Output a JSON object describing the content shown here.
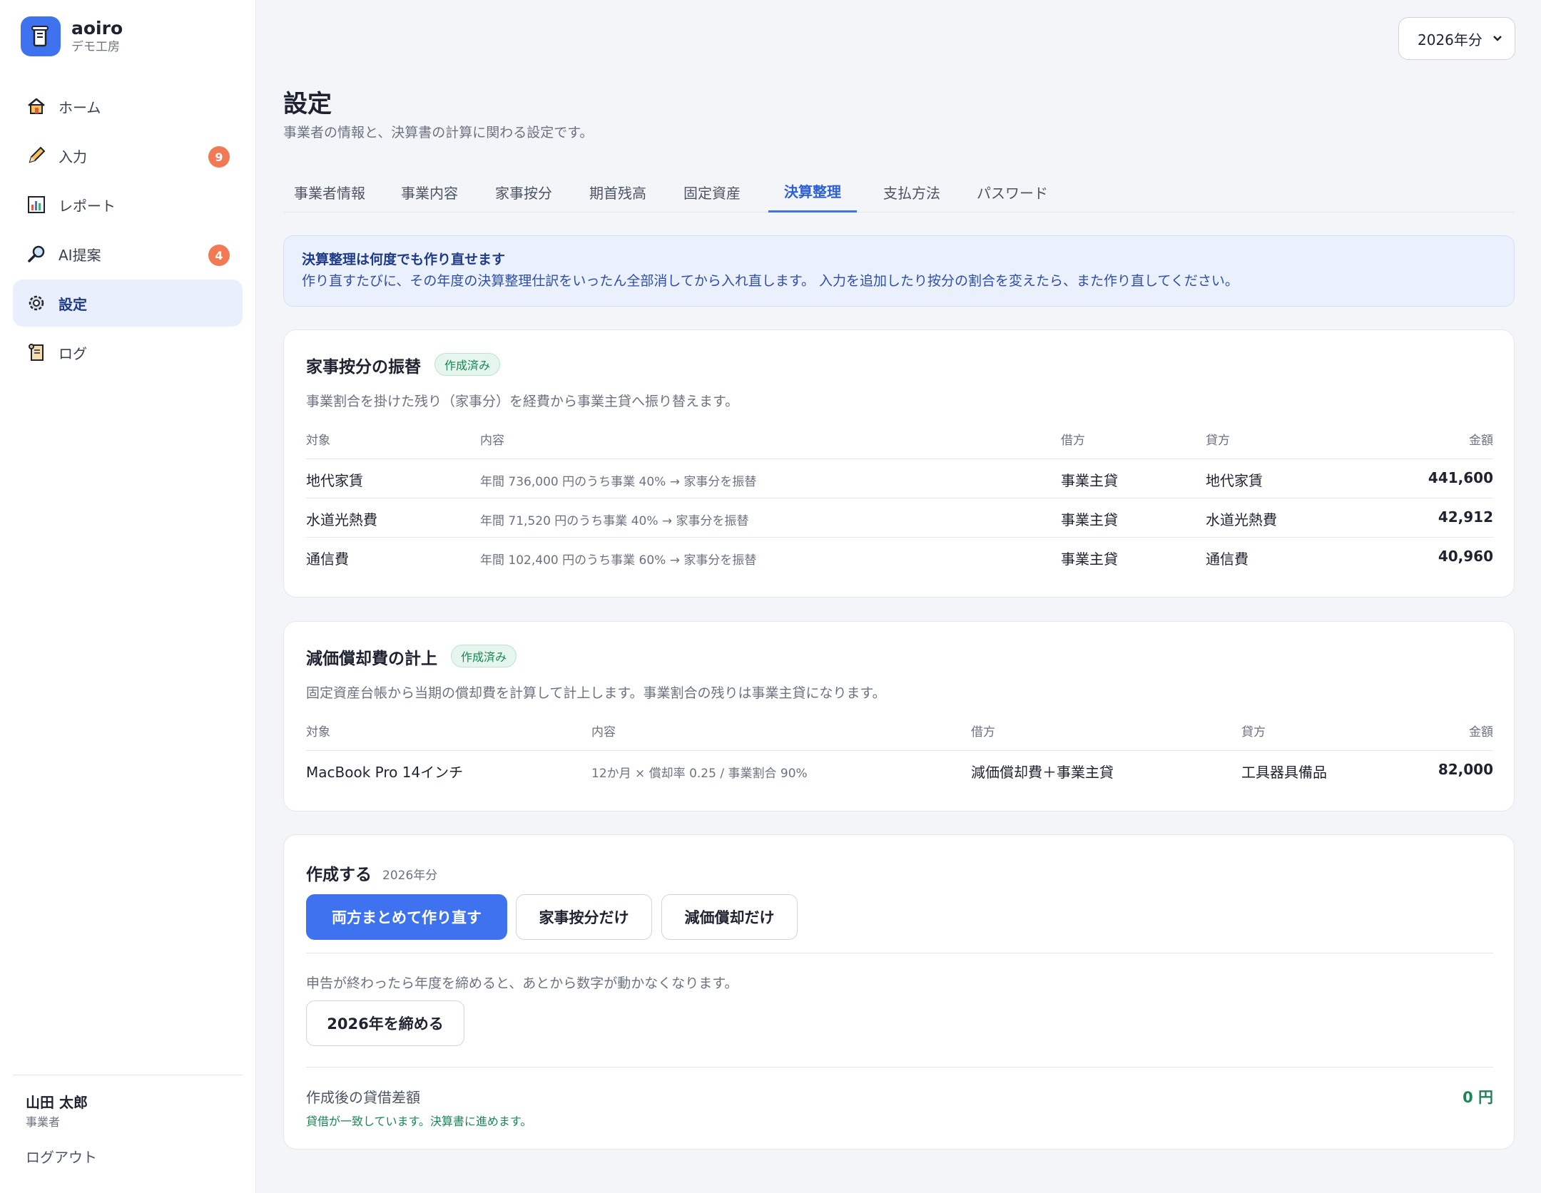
{
  "brand": {
    "name": "aoiro",
    "sub": "デモ工房"
  },
  "nav": [
    {
      "label": "ホーム",
      "icon": "home-icon"
    },
    {
      "label": "入力",
      "icon": "pencil-icon",
      "badge": "9"
    },
    {
      "label": "レポート",
      "icon": "chart-icon"
    },
    {
      "label": "AI提案",
      "icon": "magnifier-icon",
      "badge": "4"
    },
    {
      "label": "設定",
      "icon": "gear-icon",
      "active": true
    },
    {
      "label": "ログ",
      "icon": "scroll-icon"
    }
  ],
  "user": {
    "name": "山田 太郎",
    "role": "事業者",
    "logout": "ログアウト"
  },
  "year_select": {
    "value": "2026年分"
  },
  "page": {
    "title": "設定",
    "subtitle": "事業者の情報と、決算書の計算に関わる設定です。"
  },
  "tabs": [
    "事業者情報",
    "事業内容",
    "家事按分",
    "期首残高",
    "固定資産",
    "決算整理",
    "支払方法",
    "パスワード"
  ],
  "active_tab": "決算整理",
  "info": {
    "title": "決算整理は何度でも作り直せます",
    "body": "作り直すたびに、その年度の決算整理仕訳をいったん全部消してから入れ直します。 入力を追加したり按分の割合を変えたら、また作り直してください。"
  },
  "household": {
    "title": "家事按分の振替",
    "status": "作成済み",
    "desc": "事業割合を掛けた残り（家事分）を経費から事業主貸へ振り替えます。",
    "headers": {
      "target": "対象",
      "content": "内容",
      "debit": "借方",
      "credit": "貸方",
      "amount": "金額"
    },
    "rows": [
      {
        "target": "地代家賃",
        "content": "年間 736,000 円のうち事業 40% → 家事分を振替",
        "debit": "事業主貸",
        "credit": "地代家賃",
        "amount": "441,600"
      },
      {
        "target": "水道光熱費",
        "content": "年間 71,520 円のうち事業 40% → 家事分を振替",
        "debit": "事業主貸",
        "credit": "水道光熱費",
        "amount": "42,912"
      },
      {
        "target": "通信費",
        "content": "年間 102,400 円のうち事業 60% → 家事分を振替",
        "debit": "事業主貸",
        "credit": "通信費",
        "amount": "40,960"
      }
    ]
  },
  "depreciation": {
    "title": "減価償却費の計上",
    "status": "作成済み",
    "desc": "固定資産台帳から当期の償却費を計算して計上します。事業割合の残りは事業主貸になります。",
    "headers": {
      "target": "対象",
      "content": "内容",
      "debit": "借方",
      "credit": "貸方",
      "amount": "金額"
    },
    "rows": [
      {
        "target": "MacBook Pro 14インチ",
        "content": "12か月 × 償却率 0.25 / 事業割合 90%",
        "debit": "減価償却費＋事業主貸",
        "credit": "工具器具備品",
        "amount": "82,000"
      }
    ]
  },
  "create": {
    "title": "作成する",
    "year": "2026年分",
    "btn_both": "両方まとめて作り直す",
    "btn_household": "家事按分だけ",
    "btn_depreciation": "減価償却だけ",
    "close_note": "申告が終わったら年度を締めると、あとから数字が動かなくなります。",
    "btn_close": "2026年を締める",
    "diff_label": "作成後の貸借差額",
    "diff_value": "0 円",
    "diff_note": "貸借が一致しています。決算書に進めます。"
  },
  "colors": {
    "accent": "#3f72ef",
    "badge": "#f17a55",
    "success": "#198754"
  }
}
